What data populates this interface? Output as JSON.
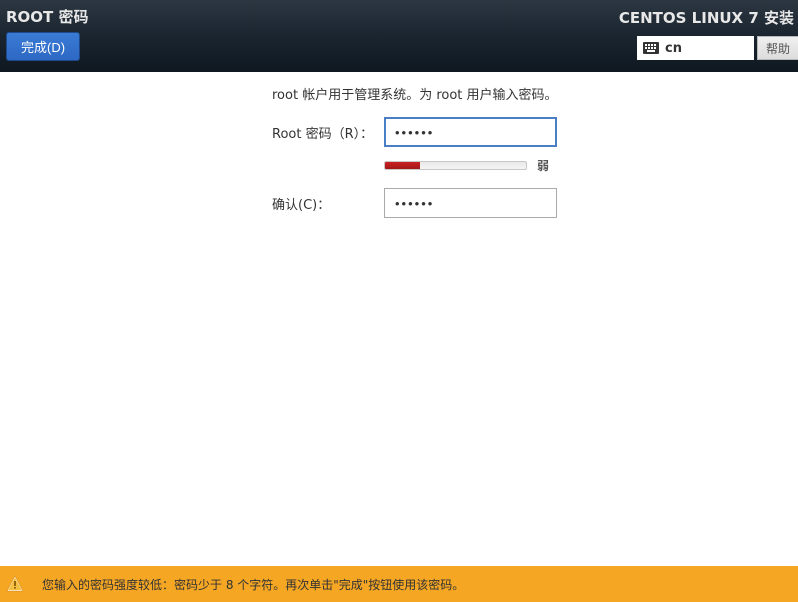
{
  "header": {
    "page_title": "ROOT 密码",
    "done_label": "完成(D)",
    "installer_title": "CENTOS LINUX 7 安装",
    "lang_code": "cn",
    "help_label": "帮助"
  },
  "form": {
    "description": "root 帐户用于管理系统。为 root 用户输入密码。",
    "password_label": "Root 密码（R）：",
    "password_value": "••••••",
    "confirm_label": "确认(C)：",
    "confirm_value": "••••••",
    "strength_label": "弱",
    "strength_percent": 25
  },
  "warning": {
    "message": "您输入的密码强度较低：密码少于 8 个字符。再次单击\"完成\"按钮使用该密码。"
  }
}
